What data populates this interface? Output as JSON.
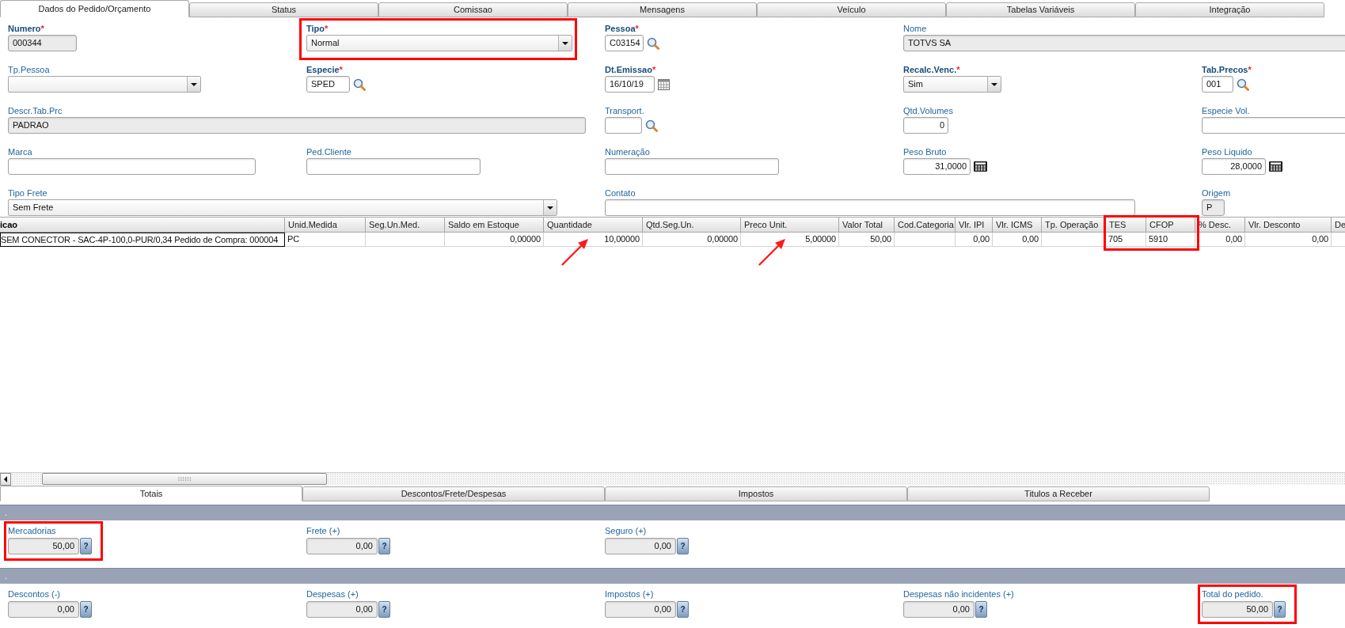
{
  "tabs": [
    {
      "label": "Dados do Pedido/Orçamento",
      "selected": true
    },
    {
      "label": "Status",
      "selected": false
    },
    {
      "label": "Comissao",
      "selected": false
    },
    {
      "label": "Mensagens",
      "selected": false
    },
    {
      "label": "Veículo",
      "selected": false
    },
    {
      "label": "Tabelas Variáveis",
      "selected": false
    },
    {
      "label": "Integração",
      "selected": false
    }
  ],
  "form": {
    "fields": [
      {
        "label": "Numero",
        "required_mark": "*",
        "kind": "text",
        "value": "000344",
        "disabled": true,
        "highlighted": false
      },
      {
        "label": "Tipo",
        "required_mark": "*",
        "kind": "select",
        "value": "Normal",
        "disabled": false,
        "highlighted": true
      },
      {
        "label": "Pessoa",
        "required_mark": "*",
        "kind": "lookup",
        "value": "C03154",
        "disabled": false,
        "highlighted": false
      },
      {
        "label": "Nome",
        "kind": "text",
        "value": "TOTVS SA",
        "disabled": true,
        "highlighted": false
      },
      {
        "label": "Tp.Pessoa",
        "kind": "select",
        "disabled": false,
        "highlighted": false
      },
      {
        "label": "Especie",
        "required_mark": "*",
        "kind": "lookup",
        "value": "SPED",
        "disabled": false,
        "highlighted": false
      },
      {
        "label": "Dt.Emissao",
        "required_mark": "*",
        "kind": "date",
        "value": "16/10/19",
        "disabled": false,
        "highlighted": false
      },
      {
        "label": "Recalc.Venc.",
        "required_mark": "*",
        "kind": "select",
        "value": "Sim",
        "disabled": false,
        "highlighted": false
      },
      {
        "label": "Tab.Precos",
        "required_mark": "*",
        "kind": "lookup",
        "value": "001",
        "disabled": false,
        "highlighted": false
      },
      {
        "label": "Descr.Tab.Prc",
        "kind": "text",
        "value": "PADRAO",
        "disabled": true,
        "highlighted": false
      },
      {
        "label": "Transport.",
        "kind": "lookup",
        "disabled": false,
        "highlighted": false
      },
      {
        "label": "Qtd.Volumes",
        "kind": "number",
        "value": "0",
        "disabled": false,
        "highlighted": false
      },
      {
        "label": "Especie Vol.",
        "kind": "text",
        "disabled": false,
        "highlighted": false
      },
      {
        "label": "Marca",
        "kind": "text",
        "disabled": false,
        "highlighted": false
      },
      {
        "label": "Ped.Cliente",
        "kind": "text",
        "disabled": false,
        "highlighted": false
      },
      {
        "label": "Numeração",
        "kind": "text",
        "disabled": false,
        "highlighted": false
      },
      {
        "label": "Peso Bruto",
        "kind": "calc",
        "value": "31,0000",
        "disabled": false,
        "highlighted": false
      },
      {
        "label": "Peso Liquido",
        "kind": "calc",
        "value": "28,0000",
        "disabled": false,
        "highlighted": false
      },
      {
        "label": "Tipo Frete",
        "kind": "select",
        "value": "Sem Frete",
        "disabled": false,
        "highlighted": false
      },
      {
        "label": "Contato",
        "kind": "text",
        "disabled": false,
        "highlighted": false
      },
      {
        "label": "Origem",
        "kind": "text",
        "value": "P",
        "disabled": true,
        "highlighted": false
      }
    ]
  },
  "table": {
    "columns": [
      {
        "label": "icao",
        "active": true,
        "highlighted": false
      },
      {
        "label": "Unid.Medida",
        "active": false,
        "highlighted": false
      },
      {
        "label": "Seg.Un.Med.",
        "active": false,
        "highlighted": false
      },
      {
        "label": "Saldo em Estoque",
        "active": false,
        "highlighted": false
      },
      {
        "label": "Quantidade",
        "active": false,
        "highlighted": false
      },
      {
        "label": "Qtd.Seg.Un.",
        "active": false,
        "highlighted": false
      },
      {
        "label": "Preco Unit.",
        "active": false,
        "highlighted": false
      },
      {
        "label": "Valor Total",
        "active": false,
        "highlighted": false
      },
      {
        "label": "Cod.Categoria",
        "active": false,
        "highlighted": false
      },
      {
        "label": "Vlr. IPI",
        "active": false,
        "highlighted": false
      },
      {
        "label": "Vlr. ICMS",
        "active": false,
        "highlighted": false
      },
      {
        "label": "Tp. Operação",
        "active": false,
        "highlighted": false
      },
      {
        "label": "TES",
        "active": false,
        "highlighted": true
      },
      {
        "label": "CFOP",
        "active": false,
        "highlighted": true
      },
      {
        "label": "% Desc.",
        "active": false,
        "highlighted": false
      },
      {
        "label": "Vlr. Desconto",
        "active": false,
        "highlighted": false
      },
      {
        "label": "De",
        "active": false,
        "highlighted": false
      }
    ],
    "rows": [
      {
        "cells": [
          {
            "text": "SEM CONECTOR - SAC-4P-100,0-PUR/0,34 Pedido de Compra: 000004",
            "focused": true,
            "arrow": false
          },
          {
            "text": "PC",
            "focused": false,
            "arrow": false
          },
          {
            "focused": false,
            "arrow": false
          },
          {
            "text": "0,00000",
            "focused": false,
            "arrow": false
          },
          {
            "text": "10,00000",
            "focused": false,
            "arrow": true
          },
          {
            "text": "0,00000",
            "focused": false,
            "arrow": false
          },
          {
            "text": "5,00000",
            "focused": false,
            "arrow": true
          },
          {
            "text": "50,00",
            "focused": false,
            "arrow": false
          },
          {
            "focused": false,
            "arrow": false
          },
          {
            "text": "0,00",
            "focused": false,
            "arrow": false
          },
          {
            "text": "0,00",
            "focused": false,
            "arrow": false
          },
          {
            "focused": false,
            "arrow": false
          },
          {
            "text": "705",
            "focused": false,
            "arrow": false
          },
          {
            "text": "5910",
            "focused": false,
            "arrow": false
          },
          {
            "text": "0,00",
            "focused": false,
            "arrow": false
          },
          {
            "text": "0,00",
            "focused": false,
            "arrow": false
          },
          {
            "focused": false,
            "arrow": false
          }
        ]
      }
    ]
  },
  "totals": {
    "tabs": [
      {
        "label": "Totais",
        "selected": true
      },
      {
        "label": "Descontos/Frete/Despesas",
        "selected": false
      },
      {
        "label": "Impostos",
        "selected": false
      },
      {
        "label": "Titulos a Receber",
        "selected": false
      }
    ],
    "sections": [
      {
        "title": ".",
        "fields": [
          {
            "label": "Mercadorias",
            "value": "50,00",
            "help": "?",
            "highlighted": true
          },
          {
            "label": "Frete (+)",
            "value": "0,00",
            "help": "?",
            "highlighted": false
          },
          {
            "label": "Seguro (+)",
            "value": "0,00",
            "help": "?",
            "highlighted": false
          }
        ]
      },
      {
        "title": ".",
        "fields": [
          {
            "label": "Descontos (-)",
            "value": "0,00",
            "help": "?",
            "highlighted": false
          },
          {
            "label": "Despesas (+)",
            "value": "0,00",
            "help": "?",
            "highlighted": false
          },
          {
            "label": "Impostos (+)",
            "value": "0,00",
            "help": "?",
            "highlighted": false
          },
          {
            "label": "Despesas não incidentes (+)",
            "value": "0,00",
            "help": "?",
            "highlighted": false
          },
          {
            "label": "Total do pedido.",
            "value": "50,00",
            "help": "?",
            "highlighted": true
          }
        ]
      }
    ]
  }
}
